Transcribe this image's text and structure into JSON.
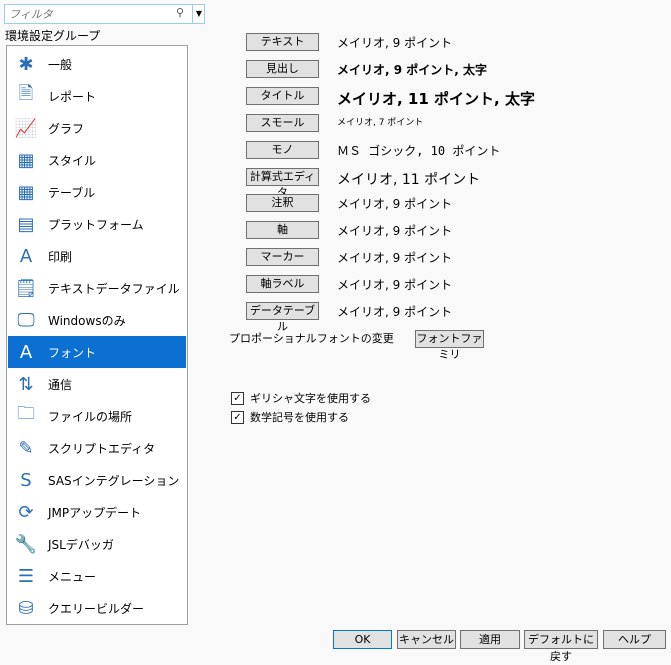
{
  "filter": {
    "placeholder": "フィルタ"
  },
  "group_label": "環境設定グループ",
  "sidebar": {
    "items": [
      {
        "label": "一般",
        "icon": "general-icon"
      },
      {
        "label": "レポート",
        "icon": "report-icon"
      },
      {
        "label": "グラフ",
        "icon": "graph-icon"
      },
      {
        "label": "スタイル",
        "icon": "style-icon"
      },
      {
        "label": "テーブル",
        "icon": "table-icon"
      },
      {
        "label": "プラットフォーム",
        "icon": "platform-icon"
      },
      {
        "label": "印刷",
        "icon": "print-icon"
      },
      {
        "label": "テキストデータファイル",
        "icon": "text-file-icon"
      },
      {
        "label": "Windowsのみ",
        "icon": "monitor-icon"
      },
      {
        "label": "フォント",
        "icon": "font-icon",
        "selected": true
      },
      {
        "label": "通信",
        "icon": "communication-icon"
      },
      {
        "label": "ファイルの場所",
        "icon": "folder-icon"
      },
      {
        "label": "スクリプトエディタ",
        "icon": "script-editor-icon"
      },
      {
        "label": "SASインテグレーション",
        "icon": "sas-icon"
      },
      {
        "label": "JMPアップデート",
        "icon": "update-icon"
      },
      {
        "label": "JSLデバッガ",
        "icon": "wrench-icon"
      },
      {
        "label": "メニュー",
        "icon": "menu-icon"
      },
      {
        "label": "クエリービルダー",
        "icon": "query-builder-icon"
      }
    ]
  },
  "fonts": [
    {
      "button": "テキスト",
      "value": "メイリオ, 9 ポイント"
    },
    {
      "button": "見出し",
      "value": "メイリオ, 9 ポイント, 太字"
    },
    {
      "button": "タイトル",
      "value": "メイリオ, 11 ポイント, 太字"
    },
    {
      "button": "スモール",
      "value": "メイリオ, 7 ポイント"
    },
    {
      "button": "モノ",
      "value": "ＭＳ ゴシック, 10 ポイント"
    },
    {
      "button": "計算式エディタ",
      "value": "メイリオ, 11 ポイント"
    },
    {
      "button": "注釈",
      "value": "メイリオ, 9 ポイント"
    },
    {
      "button": "軸",
      "value": "メイリオ, 9 ポイント"
    },
    {
      "button": "マーカー",
      "value": "メイリオ, 9 ポイント"
    },
    {
      "button": "軸ラベル",
      "value": "メイリオ, 9 ポイント"
    },
    {
      "button": "データテーブル",
      "value": "メイリオ, 9 ポイント"
    }
  ],
  "proportional": {
    "label": "プロポーショナルフォントの変更",
    "button": "フォントファミリ"
  },
  "checkboxes": [
    {
      "label": "ギリシャ文字を使用する",
      "checked": true
    },
    {
      "label": "数学記号を使用する",
      "checked": true
    }
  ],
  "footer": {
    "ok": "OK",
    "cancel": "キャンセル",
    "apply": "適用",
    "default": "デフォルトに戻す",
    "help": "ヘルプ"
  }
}
